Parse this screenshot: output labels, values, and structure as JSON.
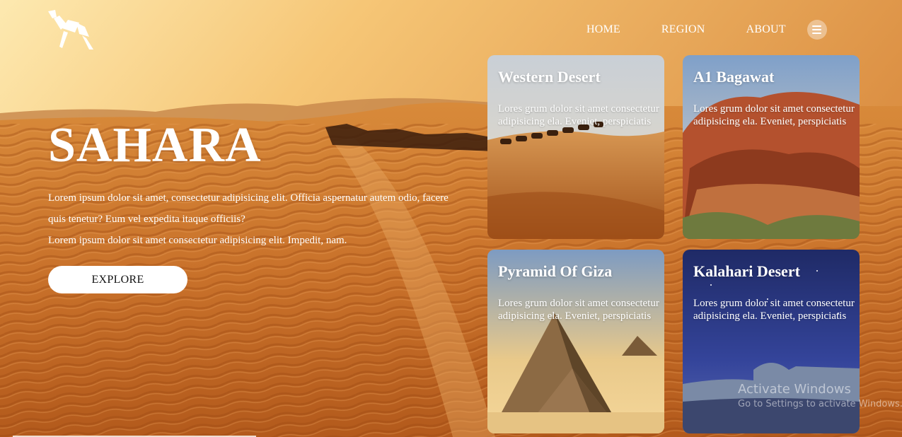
{
  "nav": {
    "items": [
      "HOME",
      "REGION",
      "ABOUT"
    ],
    "menu_icon": "hamburger-icon"
  },
  "logo": {
    "icon": "origami-camel-logo"
  },
  "hero": {
    "title": "SAHARA",
    "paragraph_1": "Lorem ipsum dolor sit amet, consectetur adipisicing elit. Officia aspernatur autem odio, facere quis tenetur? Eum vel expedita itaque officiis?",
    "paragraph_2": "Lorem ipsum dolor sit amet consectetur adipisicing elit. Impedit, nam.",
    "explore_label": "EXPLORE"
  },
  "cards": [
    {
      "title": "Western Desert",
      "text": "Lores grum dolor sit amet consectetur adipisicing ela. Eveniet, perspiciatis"
    },
    {
      "title": "A1 Bagawat",
      "text": "Lores grum dolor sit amet consectetur adipisicing ela. Eveniet, perspiciatis"
    },
    {
      "title": "Pyramid Of Giza",
      "text": "Lores grum dolor sit amet consectetur adipisicing ela. Eveniet, perspiciatis"
    },
    {
      "title": "Kalahari Desert",
      "text": "Lores grum dolor sit amet consectetur adipisicing ela. Eveniet, perspiciatis"
    }
  ],
  "watermark": {
    "title": "Activate Windows",
    "subtitle": "Go to Settings to activate Windows."
  },
  "colors": {
    "sand_light": "#f7c06e",
    "sand_mid": "#d9812f",
    "sand_dark": "#a84f15",
    "night_blue": "#24306e"
  }
}
